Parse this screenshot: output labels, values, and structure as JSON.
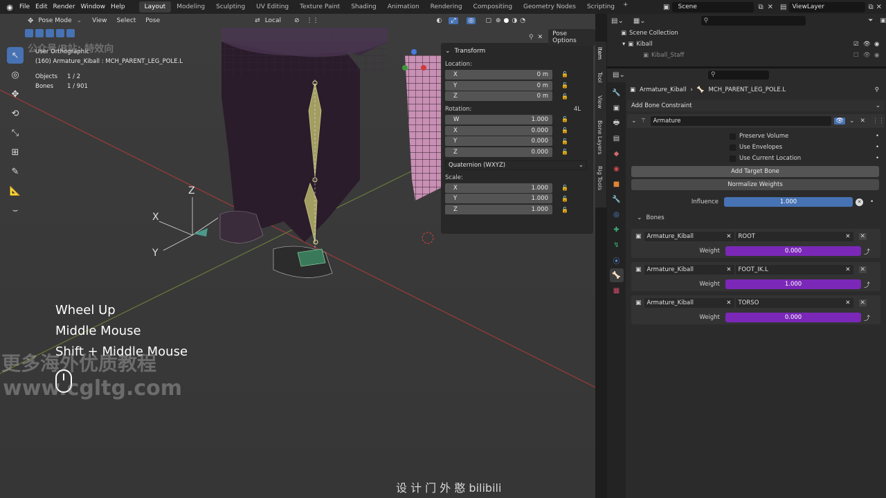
{
  "topbar": {
    "menus": [
      "File",
      "Edit",
      "Render",
      "Window",
      "Help"
    ],
    "tabs": [
      "Layout",
      "Modeling",
      "Sculpting",
      "UV Editing",
      "Texture Paint",
      "Shading",
      "Animation",
      "Rendering",
      "Compositing",
      "Geometry Nodes",
      "Scripting"
    ],
    "active_tab": "Layout",
    "plus": "+",
    "scene": "Scene",
    "view_layer": "ViewLayer"
  },
  "viewport": {
    "mode": "Pose Mode",
    "menus": [
      "View",
      "Select",
      "Pose"
    ],
    "orientation": "Local",
    "pose_options": "Pose Options",
    "info_title": "User Orthographic",
    "info_subtitle": "(160) Armature_Kiball : MCH_PARENT_LEG_POLE.L",
    "objects_label": "Objects",
    "objects_value": "1 / 2",
    "bones_label": "Bones",
    "bones_value": "1 / 901",
    "axes": {
      "x": "X",
      "y": "Y",
      "z": "Z"
    }
  },
  "transform": {
    "title": "Transform",
    "location_label": "Location:",
    "location": [
      {
        "axis": "X",
        "value": "0 m"
      },
      {
        "axis": "Y",
        "value": "0 m"
      },
      {
        "axis": "Z",
        "value": "0 m"
      }
    ],
    "rotation_label": "Rotation:",
    "rotation_mode_tag": "4L",
    "rotation": [
      {
        "axis": "W",
        "value": "1.000"
      },
      {
        "axis": "X",
        "value": "0.000"
      },
      {
        "axis": "Y",
        "value": "0.000"
      },
      {
        "axis": "Z",
        "value": "0.000"
      }
    ],
    "rotation_mode": "Quaternion (WXYZ)",
    "scale_label": "Scale:",
    "scale": [
      {
        "axis": "X",
        "value": "1.000"
      },
      {
        "axis": "Y",
        "value": "1.000"
      },
      {
        "axis": "Z",
        "value": "1.000"
      }
    ]
  },
  "side_tabs": [
    "Item",
    "Tool",
    "View",
    "Bone Layers",
    "Rig Tools"
  ],
  "outliner": {
    "root": "Scene Collection",
    "collection": "Kiball",
    "child": "Kiball_Staff"
  },
  "properties": {
    "breadcrumb_object": "Armature_Kiball",
    "breadcrumb_bone": "MCH_PARENT_LEG_POLE.L",
    "add_constraint": "Add Bone Constraint",
    "constraint_name": "Armature",
    "checkboxes": [
      "Preserve Volume",
      "Use Envelopes",
      "Use Current Location"
    ],
    "add_target": "Add Target Bone",
    "normalize": "Normalize Weights",
    "influence_label": "Influence",
    "influence_value": "1.000",
    "influence": 1.0,
    "bones_label": "Bones",
    "targets": [
      {
        "armature": "Armature_Kiball",
        "bone": "ROOT",
        "weight_label": "Weight",
        "weight": "0.000"
      },
      {
        "armature": "Armature_Kiball",
        "bone": "FOOT_IK.L",
        "weight_label": "Weight",
        "weight": "1.000"
      },
      {
        "armature": "Armature_Kiball",
        "bone": "TORSO",
        "weight_label": "Weight",
        "weight": "0.000"
      }
    ]
  },
  "overlay": {
    "keys": [
      "Wheel Up",
      "Middle Mouse",
      "Shift + Middle Mouse"
    ],
    "watermark_top": "公众号/B站: 特效向",
    "watermark_mid": "更多海外优质教程",
    "watermark_url": "www.cgltg.com",
    "caption": "设 计 门 外 憨 bilibili"
  },
  "colors": {
    "accent": "#4772b3",
    "influence_bar": "#4772b3",
    "weight_bar": "#7b28b8",
    "viewport_bg": "#3a3a3a"
  }
}
